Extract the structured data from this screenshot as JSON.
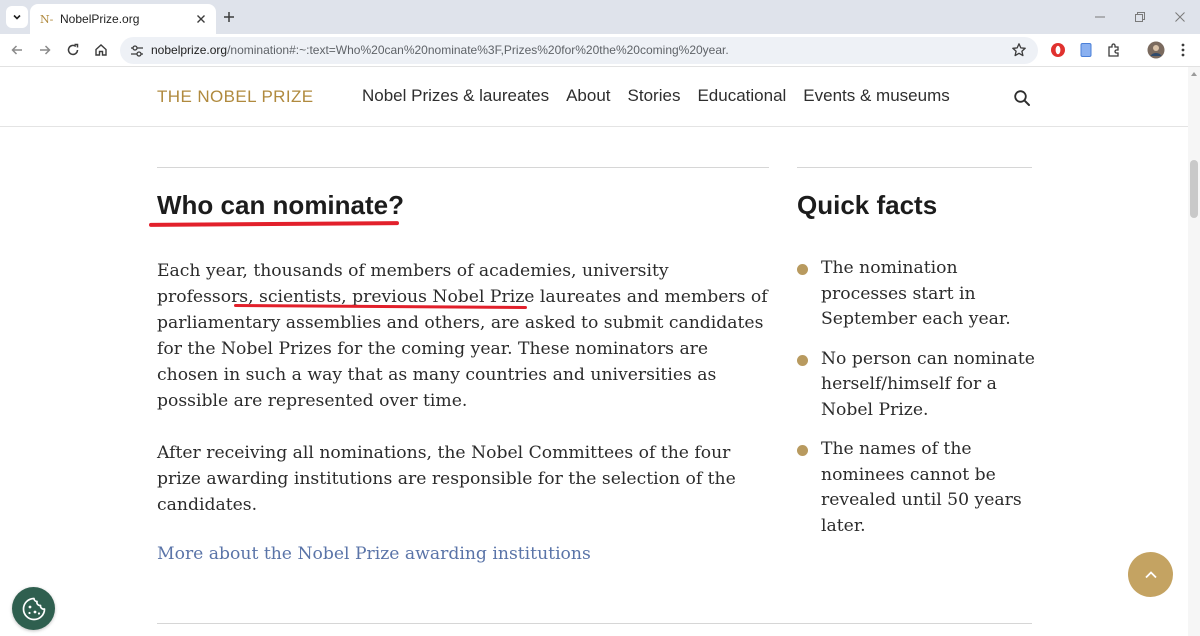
{
  "browser": {
    "tab": {
      "favicon_text": "N-",
      "title": "NobelPrize.org"
    },
    "address": {
      "host": "nobelprize.org",
      "path": "/nomination#:~:text=Who%20can%20nominate%3F,Prizes%20for%20the%20coming%20year."
    }
  },
  "site": {
    "logo": "THE NOBEL PRIZE",
    "nav": [
      "Nobel Prizes & laureates",
      "About",
      "Stories",
      "Educational",
      "Events & museums"
    ]
  },
  "article": {
    "heading": "Who can nominate?",
    "paragraphs": [
      "Each year, thousands of members of academies, university professors, scientists, previous Nobel Prize laureates and members of parliamentary assemblies and others, are asked to submit candidates for the Nobel Prizes for the coming year. These nominators are chosen in such a way that as many countries and universities as possible are represented over time.",
      "After receiving all nominations, the Nobel Committees of the four prize awarding institutions are responsible for the selection of the candidates."
    ],
    "link": "More about the Nobel Prize awarding institutions"
  },
  "quick_facts": {
    "heading": "Quick facts",
    "items": [
      "The nomination processes start in September each year.",
      "No person can nominate herself/himself for a Nobel Prize.",
      "The names of the nominees cannot be revealed until 50 years later."
    ]
  },
  "colors": {
    "brand_gold": "#b08a3e",
    "bullet": "#b89a5f",
    "link": "#5a74a8",
    "annotation_red": "#e2202b",
    "cookie_button": "#2f5f4f",
    "to_top_button": "#c4a362"
  },
  "icons": {
    "tab_menu": "chevron-down-icon",
    "tab_close": "close-icon",
    "new_tab": "plus-icon",
    "back": "arrow-left-icon",
    "forward": "arrow-right-icon",
    "reload": "reload-icon",
    "home": "home-icon",
    "site_settings": "tune-icon",
    "bookmark": "star-icon",
    "search": "search-icon",
    "scroll_to_top": "chevron-up-icon",
    "cookie": "cookie-icon"
  }
}
